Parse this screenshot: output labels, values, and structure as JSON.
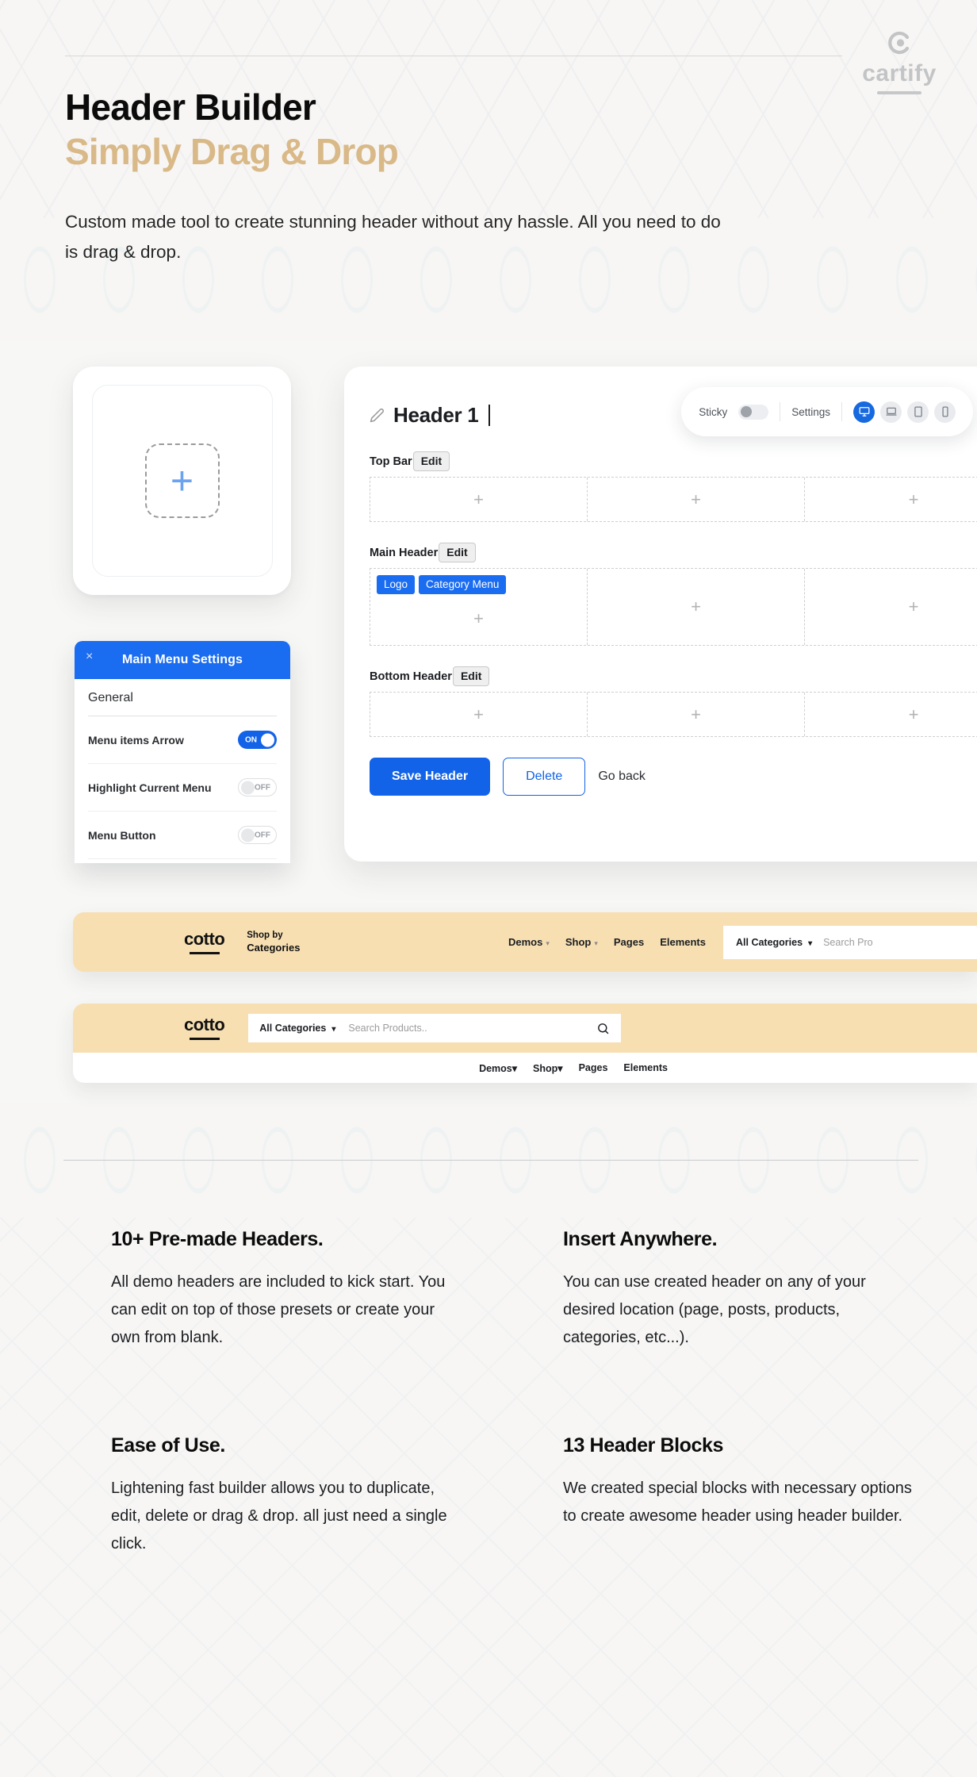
{
  "brand": {
    "name": "cartify",
    "mark": "c-circle-icon"
  },
  "hero": {
    "title": "Header Builder",
    "subtitle": "Simply Drag & Drop",
    "description": "Custom made tool to create stunning header without any hassle. All you need to do is drag & drop."
  },
  "add_card": {
    "plus": "+"
  },
  "builder": {
    "title": "Header 1",
    "toolbar": {
      "sticky_label": "Sticky",
      "sticky_state": "off",
      "settings_label": "Settings",
      "devices": [
        {
          "name": "desktop",
          "active": true
        },
        {
          "name": "laptop",
          "active": false
        },
        {
          "name": "tablet",
          "active": false
        },
        {
          "name": "mobile",
          "active": false
        }
      ]
    },
    "rows": [
      {
        "name": "Top Bar",
        "edit_label": "Edit",
        "size": "small",
        "chips": []
      },
      {
        "name": "Main Header",
        "edit_label": "Edit",
        "size": "big",
        "chips": [
          "Logo",
          "Category Menu"
        ]
      },
      {
        "name": "Bottom Header",
        "edit_label": "Edit",
        "size": "small",
        "chips": []
      }
    ],
    "cell_plus": "+",
    "actions": {
      "save_label": "Save Header",
      "delete_label": "Delete",
      "goback_label": "Go back"
    }
  },
  "settings_panel": {
    "title": "Main Menu Settings",
    "close_label": "×",
    "section": "General",
    "rows": [
      {
        "label": "Menu items Arrow",
        "state": "ON"
      },
      {
        "label": "Highlight Current Menu",
        "state": "OFF"
      },
      {
        "label": "Menu Button",
        "state": "OFF"
      }
    ]
  },
  "preview_one": {
    "logo": "cotto",
    "shopby_small": "Shop by",
    "shopby_big": "Categories",
    "nav": [
      {
        "label": "Demos",
        "caret": true
      },
      {
        "label": "Shop",
        "caret": true
      },
      {
        "label": "Pages",
        "caret": false
      },
      {
        "label": "Elements",
        "caret": false
      }
    ],
    "category_label": "All Categories",
    "search_placeholder": "Search Pro"
  },
  "preview_two": {
    "logo": "cotto",
    "category_label": "All Categories",
    "search_placeholder": "Search Products..",
    "nav": [
      {
        "label": "Demos",
        "caret": true
      },
      {
        "label": "Shop",
        "caret": true
      },
      {
        "label": "Pages",
        "caret": false
      },
      {
        "label": "Elements",
        "caret": false
      }
    ]
  },
  "features": [
    {
      "title": "10+ Pre-made Headers.",
      "body": "All demo headers are included to kick start. You can edit on top of those presets or create your own from blank."
    },
    {
      "title": "Insert Anywhere.",
      "body": "You can use created header on any of your desired location (page, posts, products, categories, etc...)."
    },
    {
      "title": "Ease of Use.",
      "body": "Lightening fast builder allows you to duplicate, edit, delete or drag & drop. all just need a single click."
    },
    {
      "title": "13 Header Blocks",
      "body": "We created special blocks with necessary options to create awesome header using header builder."
    }
  ],
  "colors": {
    "accent_blue": "#1263e8",
    "gold": "#d9b988",
    "preview_bg": "#f7dfb2",
    "page_bg": "#f7f6f4"
  }
}
